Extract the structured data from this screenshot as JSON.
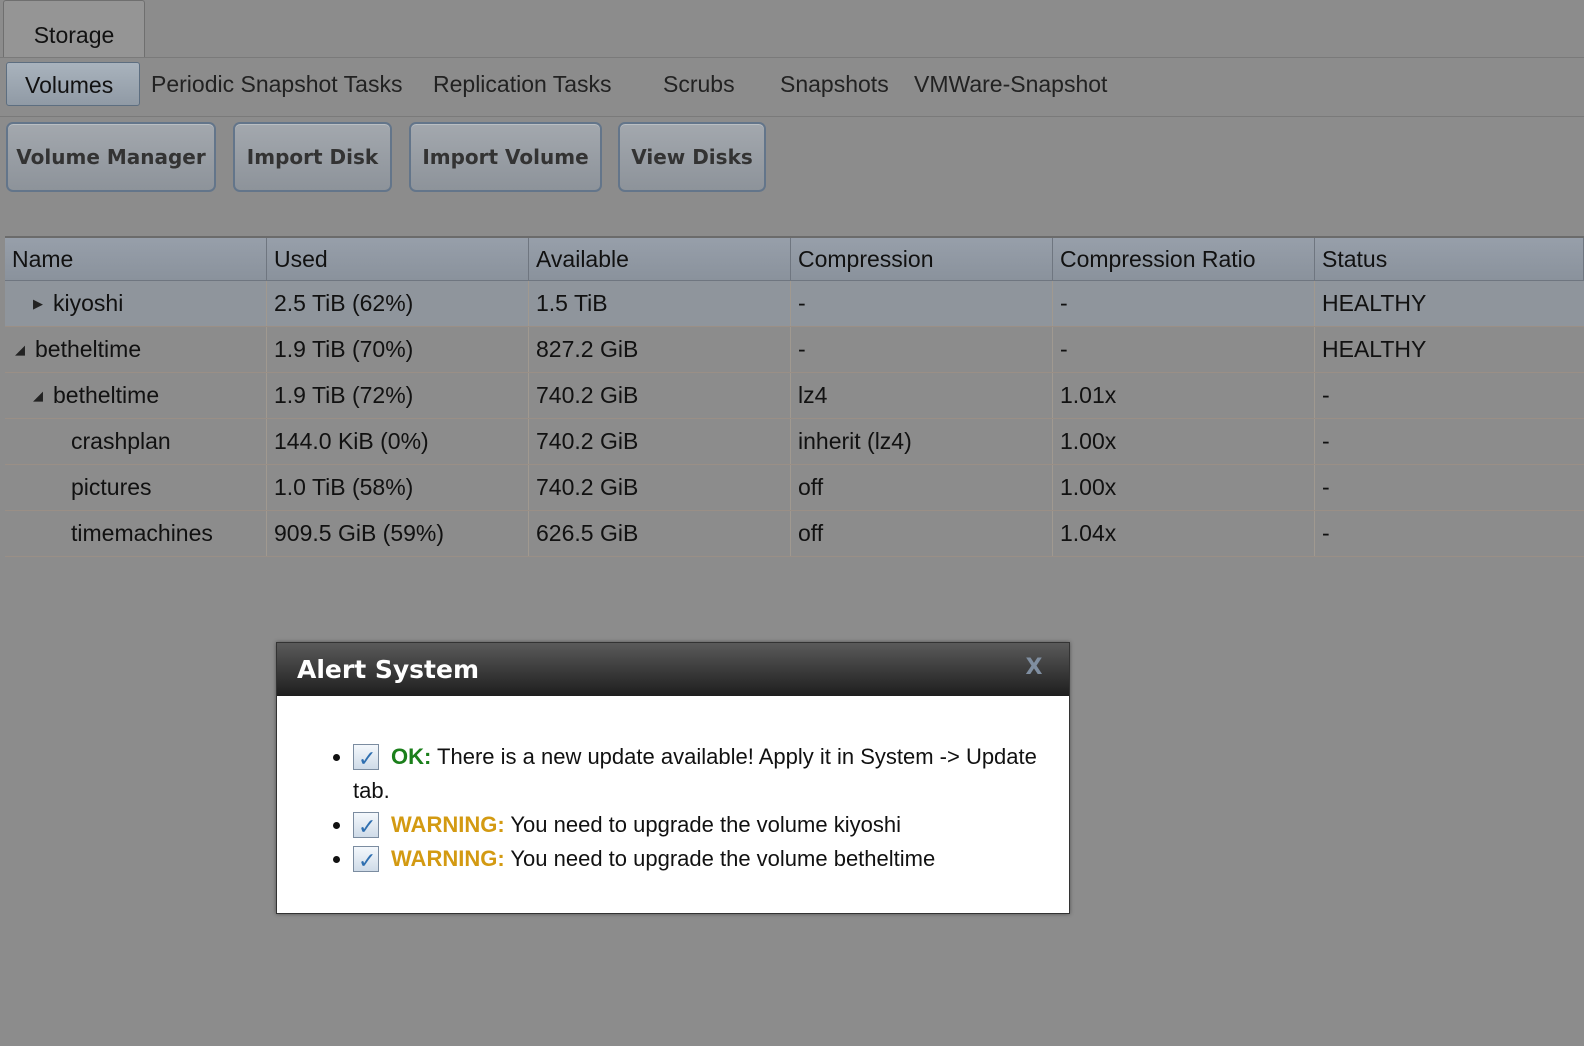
{
  "top_tab": {
    "label": "Storage"
  },
  "subtabs": [
    {
      "label": "Volumes",
      "active": true
    },
    {
      "label": "Periodic Snapshot Tasks"
    },
    {
      "label": "Replication Tasks"
    },
    {
      "label": "Scrubs"
    },
    {
      "label": "Snapshots"
    },
    {
      "label": "VMWare-Snapshot"
    }
  ],
  "toolbar": {
    "volume_manager": "Volume Manager",
    "import_disk": "Import Disk",
    "import_volume": "Import Volume",
    "view_disks": "View Disks"
  },
  "grid": {
    "columns": [
      "Name",
      "Used",
      "Available",
      "Compression",
      "Compression Ratio",
      "Status"
    ],
    "rows": [
      {
        "name": "kiyoshi",
        "used": "2.5 TiB (62%)",
        "available": "1.5 TiB",
        "compression": "-",
        "ratio": "-",
        "status": "HEALTHY"
      },
      {
        "name": "betheltime",
        "used": "1.9 TiB (70%)",
        "available": "827.2 GiB",
        "compression": "-",
        "ratio": "-",
        "status": "HEALTHY"
      },
      {
        "name": "betheltime",
        "used": "1.9 TiB (72%)",
        "available": "740.2 GiB",
        "compression": "lz4",
        "ratio": "1.01x",
        "status": "-"
      },
      {
        "name": "crashplan",
        "used": "144.0 KiB (0%)",
        "available": "740.2 GiB",
        "compression": "inherit (lz4)",
        "ratio": "1.00x",
        "status": "-"
      },
      {
        "name": "pictures",
        "used": "1.0 TiB (58%)",
        "available": "740.2 GiB",
        "compression": "off",
        "ratio": "1.00x",
        "status": "-"
      },
      {
        "name": "timemachines",
        "used": "909.5 GiB (59%)",
        "available": "626.5 GiB",
        "compression": "off",
        "ratio": "1.04x",
        "status": "-"
      }
    ]
  },
  "dialog": {
    "title": "Alert System",
    "close_glyph": "X",
    "alerts": [
      {
        "level": "OK:",
        "message": "There is a new update available! Apply it in System -> Update tab."
      },
      {
        "level": "WARNING:",
        "message": "You need to upgrade the volume kiyoshi"
      },
      {
        "level": "WARNING:",
        "message": "You need to upgrade the volume betheltime"
      }
    ]
  },
  "colors": {
    "background": "#8c8c8c",
    "ok": "#1b7f1b",
    "warning": "#d39a12"
  }
}
